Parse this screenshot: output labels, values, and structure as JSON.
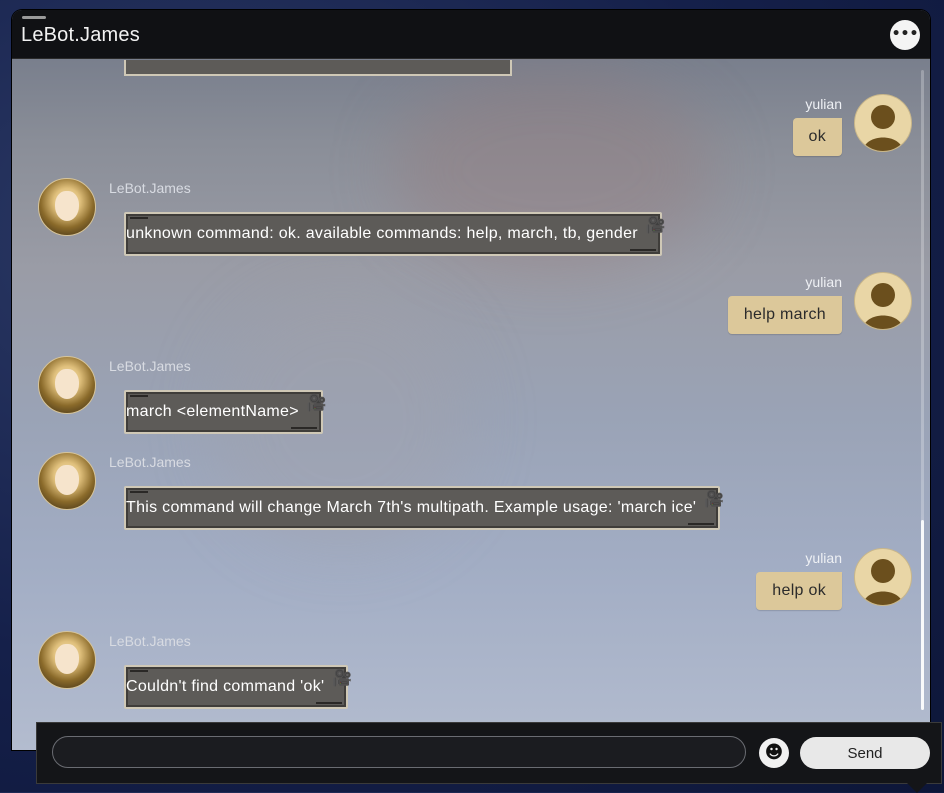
{
  "window": {
    "title": "LeBot.James",
    "more_icon": "more-icon"
  },
  "colors": {
    "user_bubble": "#dcc89a",
    "bot_bubble": "#5d5b58",
    "titlebar": "#101114"
  },
  "messages": [
    {
      "from": "user",
      "name": "yulian",
      "text": "ok"
    },
    {
      "from": "bot",
      "name": "LeBot.James",
      "text": "unknown command: ok. available commands: help, march, tb, gender"
    },
    {
      "from": "user",
      "name": "yulian",
      "text": "help march"
    },
    {
      "from": "bot",
      "name": "LeBot.James",
      "text": "march <elementName>"
    },
    {
      "from": "bot",
      "name": "LeBot.James",
      "text": "This command will change March 7th's multipath. Example usage: 'march ice'"
    },
    {
      "from": "user",
      "name": "yulian",
      "text": "help ok"
    },
    {
      "from": "bot",
      "name": "LeBot.James",
      "text": "Couldn't find command 'ok'"
    }
  ],
  "composer": {
    "input_value": "",
    "placeholder": "",
    "emoji_icon": "emoji-icon",
    "send_label": "Send"
  }
}
